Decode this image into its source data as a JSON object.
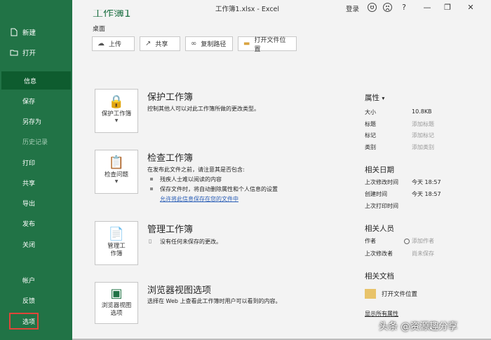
{
  "window": {
    "title": "工作簿1.xlsx  -  Excel",
    "login": "登录",
    "controls": {
      "smile": "smiley-icon",
      "frown": "frown-icon",
      "help": "?",
      "minimize": "—",
      "restore": "❐",
      "close": "✕"
    }
  },
  "colors": {
    "accent": "#217346",
    "active_nav": "#0e5c2f",
    "highlight_border": "#e0463a",
    "link": "#2a5eb6"
  },
  "sidebar": {
    "top_items": [
      {
        "label": "新建",
        "icon": "new-file-icon"
      },
      {
        "label": "打开",
        "icon": "open-folder-icon"
      }
    ],
    "items": [
      {
        "label": "信息",
        "state": "active"
      },
      {
        "label": "保存",
        "state": "normal"
      },
      {
        "label": "另存为",
        "state": "normal"
      },
      {
        "label": "历史记录",
        "state": "disabled"
      },
      {
        "label": "打印",
        "state": "normal"
      },
      {
        "label": "共享",
        "state": "normal"
      },
      {
        "label": "导出",
        "state": "normal"
      },
      {
        "label": "发布",
        "state": "normal"
      },
      {
        "label": "关闭",
        "state": "normal"
      },
      {
        "label": "帐户",
        "state": "normal"
      },
      {
        "label": "反馈",
        "state": "normal"
      },
      {
        "label": "选项",
        "state": "highlighted"
      }
    ]
  },
  "header": {
    "partial_title": "工作簿1",
    "location": "桌面",
    "buttons": [
      {
        "label": "上传",
        "icon": "cloud-upload-icon"
      },
      {
        "label": "共享",
        "icon": "share-icon"
      },
      {
        "label": "复制路径",
        "icon": "link-icon"
      },
      {
        "label": "打开文件位置",
        "icon": "folder-icon"
      }
    ]
  },
  "sections": {
    "protect": {
      "button_label": "保护工作簿",
      "title": "保护工作簿",
      "desc": "控制其他人可以对此工作簿所做的更改类型。"
    },
    "inspect": {
      "button_label": "检查问题",
      "title": "检查工作簿",
      "desc": "在发布此文件之前，请注意其是否包含:",
      "bullets": [
        "残疾人士难以阅读的内容",
        "保存文件时，将自动删除属性和个人信息的设置"
      ],
      "link": "允许将此信息保存在您的文件中"
    },
    "manage": {
      "button_label_1": "管理工",
      "button_label_2": "作簿",
      "title": "管理工作簿",
      "desc": "没有任何未保存的更改。"
    },
    "browser": {
      "button_label_1": "浏览器视图",
      "button_label_2": "选项",
      "title": "浏览器视图选项",
      "desc": "选择在 Web 上查看此工作簿时用户可以看到的内容。"
    }
  },
  "properties": {
    "heading": "属性",
    "rows": [
      {
        "key": "大小",
        "value": "10.8KB"
      },
      {
        "key": "标题",
        "value": "添加标题"
      },
      {
        "key": "标记",
        "value": "添加标记"
      },
      {
        "key": "类别",
        "value": "添加类别"
      }
    ],
    "dates_heading": "相关日期",
    "dates": [
      {
        "key": "上次修改时间",
        "value": "今天 18:57"
      },
      {
        "key": "创建时间",
        "value": "今天 18:57"
      },
      {
        "key": "上次打印时间",
        "value": ""
      }
    ],
    "people_heading": "相关人员",
    "people": [
      {
        "key": "作者",
        "value": "添加作者"
      },
      {
        "key": "上次修改者",
        "value": "尚未保存"
      }
    ],
    "docs_heading": "相关文档",
    "open_location": "打开文件位置",
    "show_all": "显示所有属性"
  },
  "watermark": "头条 @资源趣分享"
}
